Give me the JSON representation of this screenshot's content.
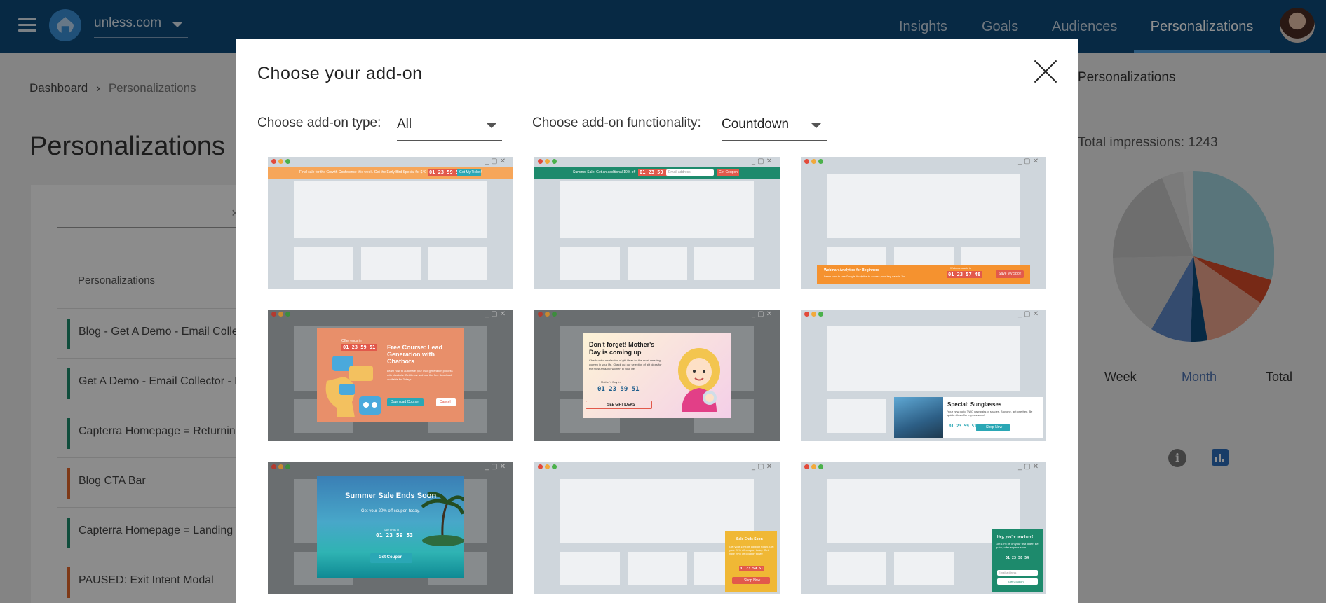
{
  "topbar": {
    "site": "unless.com",
    "nav": [
      "Insights",
      "Goals",
      "Audiences",
      "Personalizations"
    ],
    "active_nav": "Personalizations"
  },
  "breadcrumb": {
    "home": "Dashboard",
    "current": "Personalizations"
  },
  "page": {
    "title": "Personalizations",
    "card_close": "×",
    "column_header": "Personalizations",
    "rows": [
      {
        "label": "Blog - Get A Demo - Email Collec",
        "color": "#1d8a6c"
      },
      {
        "label": "Get A Demo - Email Collector - N",
        "color": "#1d8a6c"
      },
      {
        "label": "Capterra Homepage = Returning",
        "color": "#1d8a6c"
      },
      {
        "label": "Blog CTA Bar",
        "color": "#e0662a"
      },
      {
        "label": "Capterra Homepage = Landing P",
        "color": "#1d8a6c"
      },
      {
        "label": "PAUSED: Exit Intent Modal",
        "color": "#e0662a"
      }
    ]
  },
  "right_panel": {
    "title": "Personalizations",
    "total": "Total impressions: 1243",
    "tabs": [
      "Week",
      "Month",
      "Total"
    ],
    "active_tab": "Month",
    "info_icon": "i"
  },
  "modal": {
    "title": "Choose your add-on",
    "type_label": "Choose add-on type:",
    "type_value": "All",
    "func_label": "Choose add-on functionality:",
    "func_value": "Countdown"
  },
  "thumbs": {
    "bar1": "Final sale for the Growth Conference this week. Get the Early Bird Special for $40",
    "bar1_btn": "Get My Ticket!",
    "bar2": "Summer Sale: Get an additional 10% off",
    "bar2_input": "Email address",
    "bar2_btn": "Get Coupon",
    "webinar_title": "Webinar: Analytics for Beginners",
    "webinar_sub": "Learn how to use Google Analytics to access your key data in 1hr",
    "webinar_starts": "Webinar starts in",
    "webinar_btn": "Save My Spot!",
    "course_offer": "Offer ends in",
    "course_title": "Free Course: Lead Generation with Chatbots",
    "course_body": "Learn how to automate your lead generation process with chatbots. Get it now and use the free download available for 3 days",
    "course_btn": "Download Course",
    "course_cancel": "Cancel",
    "mother_title": "Don't forget! Mother's Day is coming up",
    "mother_body": "Check out our selection of gift ideas for the most amazing women in your life. Check out our selection of gift ideas for the most amazing women in your life",
    "mother_label": "Mother's Day in",
    "mother_btn": "SEE GIFT IDEAS",
    "sun_title": "Special: Sunglasses",
    "sun_body": "Your new go-to TWO new pairs of shades. Buy one, get one free. Be quick - this offer expires soon!",
    "sun_btn": "Shop Now",
    "summer_title": "Summer Sale Ends Soon",
    "summer_sub": "Get your 20% off coupon today.",
    "summer_label": "Sale ends in",
    "summer_btn": "Get Coupon",
    "corner_title": "Sale Ends Soon",
    "corner_body": "Get your 10% off coupon today. Get your 20% off coupon today. Get your 20% off coupon today.",
    "corner_btn": "Shop Now",
    "hey_title": "Hey, you're new here!",
    "hey_body": "Get 10% off on your first order! Be quick, offer expires soon",
    "hey_input": "Email address",
    "hey_btn": "Get Coupon",
    "counter": "01 23 59 51",
    "counter_b": "01 23 59 53",
    "counter_c": "01 23 57 48",
    "counter_d": "01 23 58 54"
  }
}
